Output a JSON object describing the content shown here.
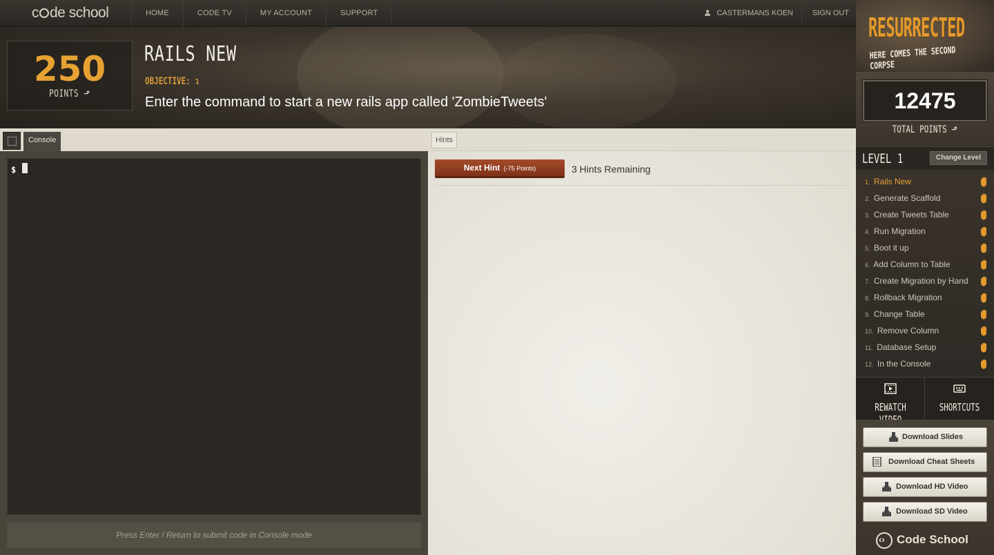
{
  "brand": {
    "logo_text_pre": "c",
    "logo_text_post": "de school"
  },
  "nav": {
    "items": [
      {
        "label": "HOME"
      },
      {
        "label": "CODE TV"
      },
      {
        "label": "MY ACCOUNT"
      },
      {
        "label": "SUPPORT"
      }
    ],
    "user_name": "CASTERMANS KOEN",
    "sign_out": "SIGN OUT"
  },
  "challenge": {
    "points_value": "250",
    "points_label": "POINTS",
    "title": "RAILS NEW",
    "objective_label": "OBJECTIVE:",
    "objective_text": "Enter the command to start a new rails app called 'ZombieTweets'"
  },
  "console": {
    "tab_label": "Console",
    "prompt": "$",
    "input_value": "",
    "footer_hint": "Press Enter / Return to submit code in Console mode"
  },
  "hints": {
    "tab_label": "Hints",
    "next_hint_label": "Next Hint",
    "next_hint_cost": "(-75 Points)",
    "remaining": "3 Hints Remaining"
  },
  "sidebar": {
    "course_title": "RESURRECTED",
    "course_subtitle": "HERE COMES THE SECOND CORPSE",
    "total_points": "12475",
    "total_points_label": "TOTAL POINTS",
    "level_label": "LEVEL 1",
    "change_level": "Change Level",
    "levels": [
      {
        "num": "1.",
        "label": "Rails New",
        "active": true
      },
      {
        "num": "2.",
        "label": "Generate Scaffold"
      },
      {
        "num": "3.",
        "label": "Create Tweets Table"
      },
      {
        "num": "4.",
        "label": "Run Migration"
      },
      {
        "num": "5.",
        "label": "Boot it up"
      },
      {
        "num": "6.",
        "label": "Add Column to Table"
      },
      {
        "num": "7.",
        "label": "Create Migration by Hand"
      },
      {
        "num": "8.",
        "label": "Rollback Migration"
      },
      {
        "num": "9.",
        "label": "Change Table"
      },
      {
        "num": "10.",
        "label": "Remove Column"
      },
      {
        "num": "11.",
        "label": "Database Setup"
      },
      {
        "num": "12.",
        "label": "In the Console"
      }
    ],
    "rewatch_video": "REWATCH VIDEO",
    "shortcuts": "SHORTCUTS",
    "downloads": [
      {
        "label": "Download Slides",
        "icon": "download-icon"
      },
      {
        "label": "Download Cheat Sheets",
        "icon": "document-icon"
      },
      {
        "label": "Download HD Video",
        "icon": "download-icon"
      },
      {
        "label": "Download SD Video",
        "icon": "download-icon"
      }
    ],
    "footer_brand": "Code School"
  },
  "colors": {
    "accent_orange": "#e6a233",
    "hint_button": "#9a4327",
    "terminal_bg": "#2b2722"
  }
}
